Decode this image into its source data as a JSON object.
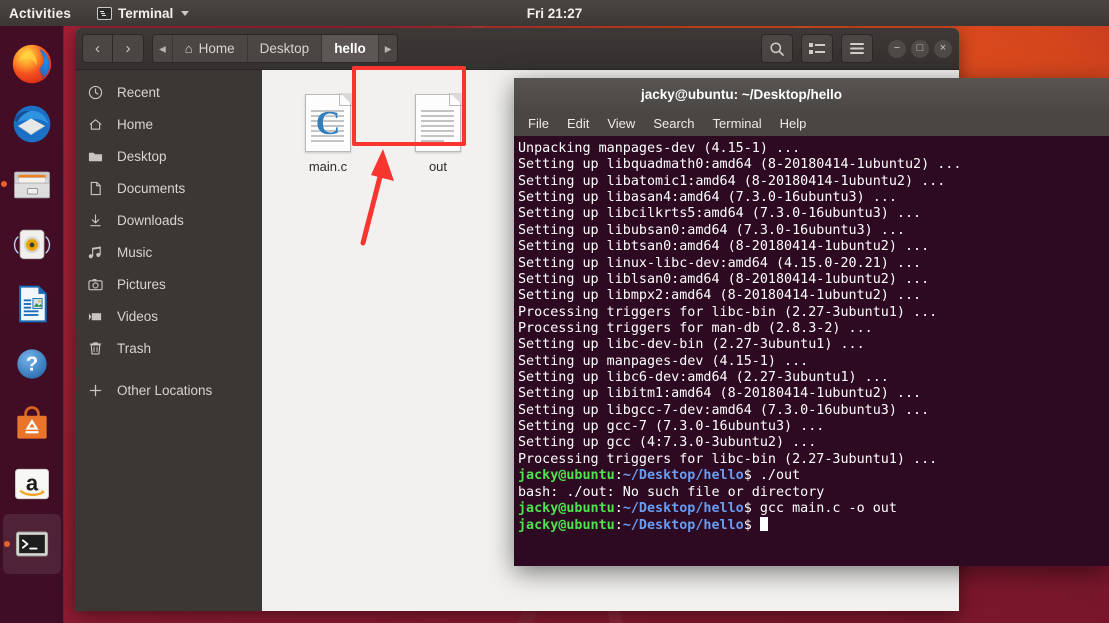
{
  "topbar": {
    "activities": "Activities",
    "app_name": "Terminal",
    "app_icon": "terminal-icon",
    "clock": "Fri 21:27"
  },
  "dock": {
    "items": [
      {
        "name": "firefox",
        "label": "Firefox",
        "running": false
      },
      {
        "name": "thunderbird",
        "label": "Thunderbird",
        "running": false
      },
      {
        "name": "files",
        "label": "Files",
        "running": true
      },
      {
        "name": "rhythmbox",
        "label": "Rhythmbox",
        "running": false
      },
      {
        "name": "libreoffice-impress",
        "label": "LibreOffice Impress",
        "running": false
      },
      {
        "name": "help",
        "label": "Help",
        "running": false
      },
      {
        "name": "ubuntu-software",
        "label": "Ubuntu Software",
        "running": false
      },
      {
        "name": "amazon",
        "label": "Amazon",
        "running": false
      },
      {
        "name": "terminal",
        "label": "Terminal",
        "running": true
      }
    ]
  },
  "file_manager": {
    "nav": {
      "back": "‹",
      "forward": "›"
    },
    "breadcrumbs": [
      {
        "label": "◂",
        "type": "scroll-left",
        "active": false
      },
      {
        "label": "Home",
        "type": "path",
        "icon": "home-icon",
        "active": false
      },
      {
        "label": "Desktop",
        "type": "path",
        "active": false
      },
      {
        "label": "hello",
        "type": "path",
        "active": true
      },
      {
        "label": "▸",
        "type": "scroll-right",
        "active": false
      }
    ],
    "toolbar": {
      "search": "search-icon",
      "view_list": "list-view-icon",
      "menu": "hamburger-menu-icon",
      "minimize": "−",
      "maximize": "□",
      "close": "×"
    },
    "sidebar": [
      {
        "label": "Recent",
        "icon": "clock-icon"
      },
      {
        "label": "Home",
        "icon": "home-icon"
      },
      {
        "label": "Desktop",
        "icon": "folder-icon"
      },
      {
        "label": "Documents",
        "icon": "document-icon"
      },
      {
        "label": "Downloads",
        "icon": "download-icon"
      },
      {
        "label": "Music",
        "icon": "music-note-icon"
      },
      {
        "label": "Pictures",
        "icon": "camera-icon"
      },
      {
        "label": "Videos",
        "icon": "video-icon"
      },
      {
        "label": "Trash",
        "icon": "trash-icon"
      },
      {
        "label": "Other Locations",
        "icon": "plus-icon"
      }
    ],
    "files": [
      {
        "name": "main.c",
        "icon": "c-source-file-icon",
        "selected": false
      },
      {
        "name": "out",
        "icon": "text-file-icon",
        "selected": true
      }
    ]
  },
  "annotation": {
    "highlight_color": "#f8352f",
    "target": "out",
    "arrow": "red-arrow-pointing-to-out-file"
  },
  "terminal": {
    "title": "jacky@ubuntu: ~/Desktop/hello",
    "menu": [
      "File",
      "Edit",
      "View",
      "Search",
      "Terminal",
      "Help"
    ],
    "prompt": {
      "user_host": "jacky@ubuntu",
      "path": "~/Desktop/hello",
      "symbol": "$"
    },
    "colors": {
      "background": "#2d0922",
      "user_host": "#4ee44e",
      "path": "#6a9cf0",
      "text": "#ffffff"
    },
    "lines": [
      {
        "type": "output",
        "text": "Unpacking manpages-dev (4.15-1) ..."
      },
      {
        "type": "output",
        "text": "Setting up libquadmath0:amd64 (8-20180414-1ubuntu2) ..."
      },
      {
        "type": "output",
        "text": "Setting up libatomic1:amd64 (8-20180414-1ubuntu2) ..."
      },
      {
        "type": "output",
        "text": "Setting up libasan4:amd64 (7.3.0-16ubuntu3) ..."
      },
      {
        "type": "output",
        "text": "Setting up libcilkrts5:amd64 (7.3.0-16ubuntu3) ..."
      },
      {
        "type": "output",
        "text": "Setting up libubsan0:amd64 (7.3.0-16ubuntu3) ..."
      },
      {
        "type": "output",
        "text": "Setting up libtsan0:amd64 (8-20180414-1ubuntu2) ..."
      },
      {
        "type": "output",
        "text": "Setting up linux-libc-dev:amd64 (4.15.0-20.21) ..."
      },
      {
        "type": "output",
        "text": "Setting up liblsan0:amd64 (8-20180414-1ubuntu2) ..."
      },
      {
        "type": "output",
        "text": "Setting up libmpx2:amd64 (8-20180414-1ubuntu2) ..."
      },
      {
        "type": "output",
        "text": "Processing triggers for libc-bin (2.27-3ubuntu1) ..."
      },
      {
        "type": "output",
        "text": "Processing triggers for man-db (2.8.3-2) ..."
      },
      {
        "type": "output",
        "text": "Setting up libc-dev-bin (2.27-3ubuntu1) ..."
      },
      {
        "type": "output",
        "text": "Setting up manpages-dev (4.15-1) ..."
      },
      {
        "type": "output",
        "text": "Setting up libc6-dev:amd64 (2.27-3ubuntu1) ..."
      },
      {
        "type": "output",
        "text": "Setting up libitm1:amd64 (8-20180414-1ubuntu2) ..."
      },
      {
        "type": "output",
        "text": "Setting up libgcc-7-dev:amd64 (7.3.0-16ubuntu3) ..."
      },
      {
        "type": "output",
        "text": "Setting up gcc-7 (7.3.0-16ubuntu3) ..."
      },
      {
        "type": "output",
        "text": "Setting up gcc (4:7.3.0-3ubuntu2) ..."
      },
      {
        "type": "output",
        "text": "Processing triggers for libc-bin (2.27-3ubuntu1) ..."
      },
      {
        "type": "prompt",
        "command": "./out"
      },
      {
        "type": "output",
        "text": "bash: ./out: No such file or directory"
      },
      {
        "type": "prompt",
        "command": "gcc main.c -o out"
      },
      {
        "type": "prompt",
        "command": "",
        "cursor": true
      }
    ]
  }
}
